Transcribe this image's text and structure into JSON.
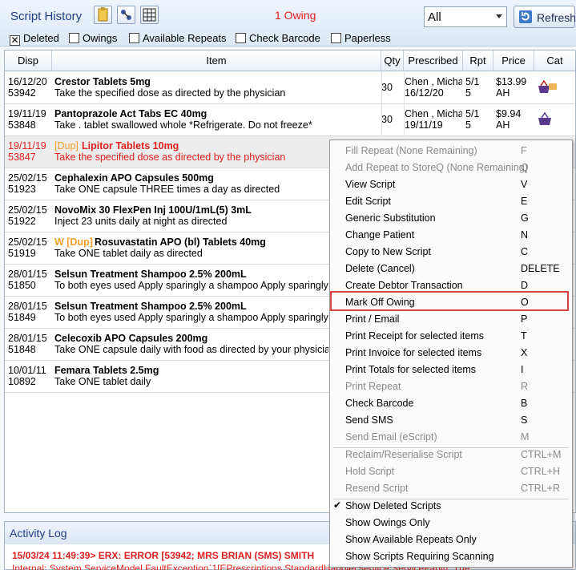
{
  "header": {
    "title": "Script History",
    "owing_text": "1 Owing",
    "filter_value": "All",
    "refresh_label": "Refresh",
    "checkboxes": [
      {
        "label": "Deleted",
        "checked": true
      },
      {
        "label": "Owings",
        "checked": false
      },
      {
        "label": "Available Repeats",
        "checked": false
      },
      {
        "label": "Check Barcode",
        "checked": false
      },
      {
        "label": "Paperless",
        "checked": false
      }
    ]
  },
  "columns": [
    "Disp",
    "Item",
    "Qty",
    "Prescribed",
    "Rpt",
    "Price",
    "Cat"
  ],
  "rows": [
    {
      "date": "16/12/20",
      "num": "53942",
      "flag": "",
      "item": "Crestor Tablets 5mg",
      "dir": "Take the specified dose as directed by the physician",
      "qty": "30",
      "prescriber": "Chen , Micha",
      "pdate": "16/12/20",
      "rpt1": "5/1",
      "rpt2": "5",
      "price": "$13.99",
      "price2": "AH",
      "cat": "basket-cart-icon"
    },
    {
      "date": "19/11/19",
      "num": "53848",
      "flag": "",
      "item": "Pantoprazole Act Tabs EC 40mg",
      "dir": "Take . tablet swallowed whole *Refrigerate. Do not freeze*",
      "qty": "30",
      "prescriber": "Chen , Micha",
      "pdate": "19/11/19",
      "rpt1": "5/1",
      "rpt2": "5",
      "price": "$9.94",
      "price2": "AH",
      "cat": "basket-icon"
    },
    {
      "date": "19/11/19",
      "num": "53847",
      "flag": "[Dup]",
      "item": "Lipitor Tablets 10mg",
      "dir": "Take the specified dose as directed by the physician",
      "qty": "",
      "prescriber": "",
      "pdate": "",
      "rpt1": "",
      "rpt2": "",
      "price": "",
      "price2": "",
      "cat": ""
    },
    {
      "date": "25/02/15",
      "num": "51923",
      "flag": "",
      "item": "Cephalexin APO Capsules 500mg",
      "dir": "Take ONE capsule THREE times a day as directed",
      "qty": "",
      "prescriber": "",
      "pdate": "",
      "rpt1": "",
      "rpt2": "",
      "price": "",
      "price2": "",
      "cat": ""
    },
    {
      "date": "25/02/15",
      "num": "51922",
      "flag": "",
      "item": "NovoMix 30 FlexPen Inj 100U/1mL(5) 3mL",
      "dir": "Inject 23 units daily at night as directed",
      "qty": "",
      "prescriber": "",
      "pdate": "",
      "rpt1": "",
      "rpt2": "",
      "price": "",
      "price2": "",
      "cat": ""
    },
    {
      "date": "25/02/15",
      "num": "51919",
      "flag": "W [Dup]",
      "item": "Rosuvastatin APO (bl) Tablets 40mg",
      "dir": "Take ONE tablet daily as directed",
      "qty": "",
      "prescriber": "",
      "pdate": "",
      "rpt1": "",
      "rpt2": "",
      "price": "",
      "price2": "",
      "cat": ""
    },
    {
      "date": "28/01/15",
      "num": "51850",
      "flag": "",
      "item": "Selsun Treatment Shampoo 2.5% 200mL",
      "dir": "To both eyes used Apply sparingly a shampoo Apply sparingly",
      "qty": "",
      "prescriber": "",
      "pdate": "",
      "rpt1": "",
      "rpt2": "",
      "price": "",
      "price2": "",
      "cat": ""
    },
    {
      "date": "28/01/15",
      "num": "51849",
      "flag": "",
      "item": "Selsun Treatment Shampoo 2.5% 200mL",
      "dir": "To both eyes used Apply sparingly a shampoo Apply sparingly",
      "qty": "",
      "prescriber": "",
      "pdate": "",
      "rpt1": "",
      "rpt2": "",
      "price": "",
      "price2": "",
      "cat": ""
    },
    {
      "date": "28/01/15",
      "num": "51848",
      "flag": "",
      "item": "Celecoxib APO Capsules 200mg",
      "dir": "Take ONE capsule daily with food as directed by your physician",
      "qty": "",
      "prescriber": "",
      "pdate": "",
      "rpt1": "",
      "rpt2": "",
      "price": "",
      "price2": "",
      "cat": ""
    },
    {
      "date": "10/01/11",
      "num": "10892",
      "flag": "",
      "item": "Femara Tablets 2.5mg",
      "dir": "Take ONE tablet daily",
      "qty": "",
      "prescriber": "",
      "pdate": "",
      "rpt1": "",
      "rpt2": "",
      "price": "",
      "price2": "",
      "cat": ""
    }
  ],
  "activity": {
    "title": "Activity Log",
    "line1": "15/03/24 11:49:39> ERX: ERROR [53942; MRS BRIAN (SMS) SMITH",
    "line2": "Internal: System.ServiceModel.FaultException`1[EPrescriptions.StandardHandlerService.ServiceFault]: The"
  },
  "context_menu": [
    {
      "label": "Fill Repeat (None Remaining)",
      "shortcut": "F",
      "enabled": false
    },
    {
      "label": "Add Repeat to StoreQ (None Remaining)",
      "shortcut": "Q",
      "enabled": false
    },
    {
      "label": "View Script",
      "shortcut": "V",
      "enabled": true
    },
    {
      "label": "Edit Script",
      "shortcut": "E",
      "enabled": true
    },
    {
      "label": "Generic Substitution",
      "shortcut": "G",
      "enabled": true
    },
    {
      "label": "Change Patient",
      "shortcut": "N",
      "enabled": true
    },
    {
      "label": "Copy to New Script",
      "shortcut": "C",
      "enabled": true
    },
    {
      "label": "Delete (Cancel)",
      "shortcut": "DELETE",
      "enabled": true
    },
    {
      "label": "Create Debtor Transaction",
      "shortcut": "D",
      "enabled": true
    },
    {
      "label": "Mark Off Owing",
      "shortcut": "O",
      "enabled": true,
      "highlighted": true
    },
    {
      "label": "Print / Email",
      "shortcut": "P",
      "enabled": true
    },
    {
      "label": "Print Receipt for selected items",
      "shortcut": "T",
      "enabled": true
    },
    {
      "label": "Print Invoice for selected items",
      "shortcut": "X",
      "enabled": true
    },
    {
      "label": "Print Totals for selected items",
      "shortcut": "I",
      "enabled": true
    },
    {
      "label": "Print Repeat",
      "shortcut": "R",
      "enabled": false
    },
    {
      "label": "Check Barcode",
      "shortcut": "B",
      "enabled": true
    },
    {
      "label": "Send SMS",
      "shortcut": "S",
      "enabled": true
    },
    {
      "label": "Send Email (eScript)",
      "shortcut": "M",
      "enabled": false
    },
    {
      "label": "Reclaim/Reserialise Script",
      "shortcut": "CTRL+M",
      "enabled": false
    },
    {
      "label": "Hold Script",
      "shortcut": "CTRL+H",
      "enabled": false
    },
    {
      "label": "Resend Script",
      "shortcut": "CTRL+R",
      "enabled": false
    },
    {
      "label": "Show Deleted Scripts",
      "shortcut": "",
      "enabled": true,
      "checked": true
    },
    {
      "label": "Show Owings Only",
      "shortcut": "",
      "enabled": true
    },
    {
      "label": "Show Available Repeats Only",
      "shortcut": "",
      "enabled": true
    },
    {
      "label": "Show Scripts Requiring Scanning",
      "shortcut": "",
      "enabled": true
    }
  ]
}
